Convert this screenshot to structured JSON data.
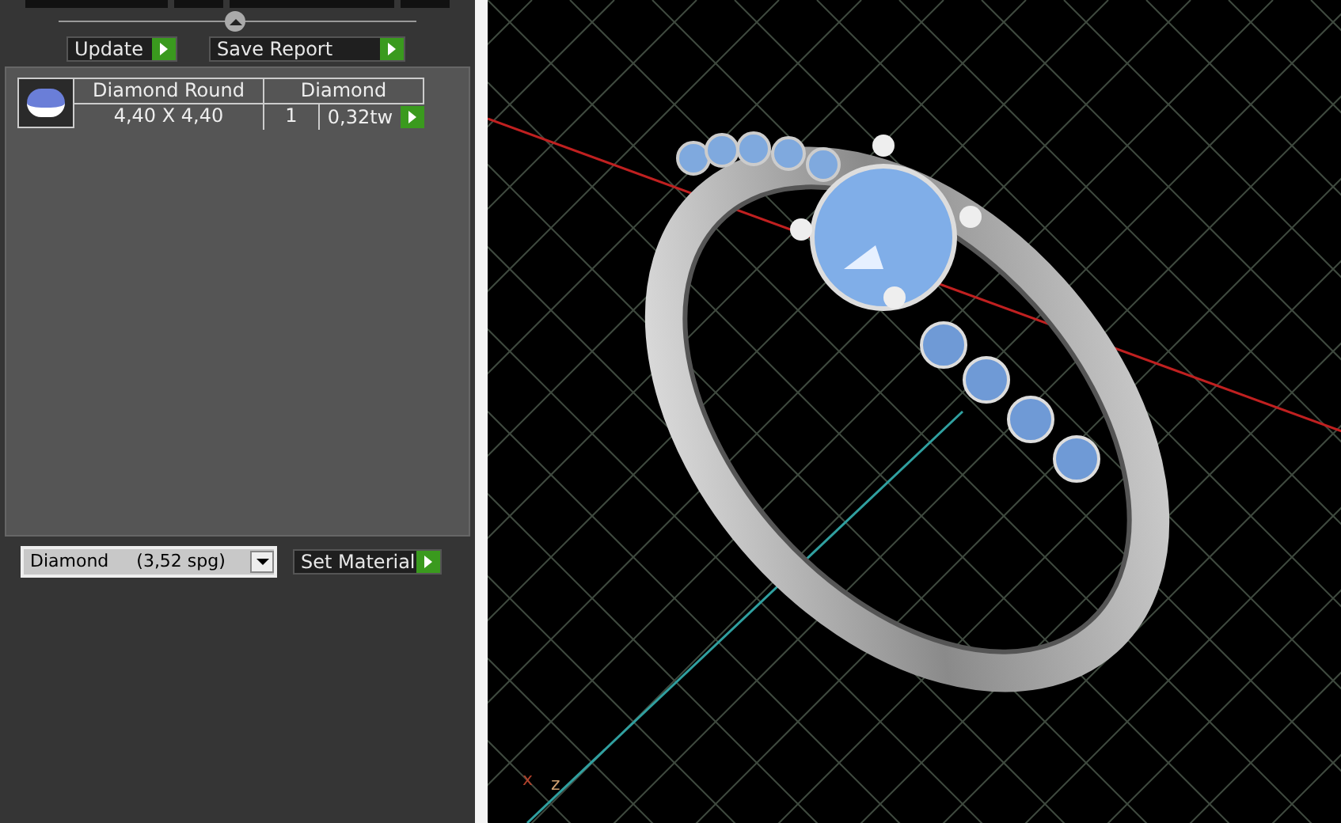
{
  "actions": [
    {
      "label": "Update"
    },
    {
      "label": "Save Report"
    }
  ],
  "stones": [
    {
      "name": "Diamond Round",
      "size": "4,40 X 4,40",
      "material": "Diamond",
      "count": "1",
      "weight": "0,32tw"
    }
  ],
  "material_select": {
    "value": "Diamond     (3,52 spg)"
  },
  "set_material": {
    "label": "Set Material"
  },
  "viewport": {
    "axis_labels": [
      {
        "kind": "x",
        "text": "x"
      },
      {
        "kind": "z",
        "text": "z"
      }
    ]
  }
}
